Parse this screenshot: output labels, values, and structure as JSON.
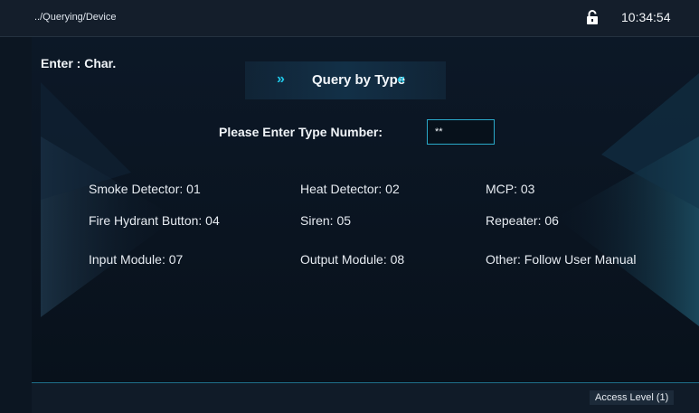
{
  "header": {
    "breadcrumb": "../Querying/Device",
    "lock_icon": "unlocked-padlock-icon",
    "time": "10:34:54"
  },
  "main": {
    "mode_label": "Enter : Char.",
    "title": "Query by Type",
    "title_chevron_left": "»",
    "title_chevron_right": "«",
    "prompt": "Please Enter Type Number:",
    "input_value": "**",
    "type_items": [
      "Smoke Detector: 01",
      "Heat Detector: 02",
      "MCP: 03",
      "Fire Hydrant Button: 04",
      "Siren: 05",
      "Repeater: 06",
      "Input Module: 07",
      "Output Module: 08",
      "Other: Follow User Manual"
    ]
  },
  "footer": {
    "access_level": "Access Level  (1)"
  },
  "colors": {
    "accent": "#20c8e8",
    "background": "#0c1622",
    "input_border": "#2aa9c9"
  }
}
